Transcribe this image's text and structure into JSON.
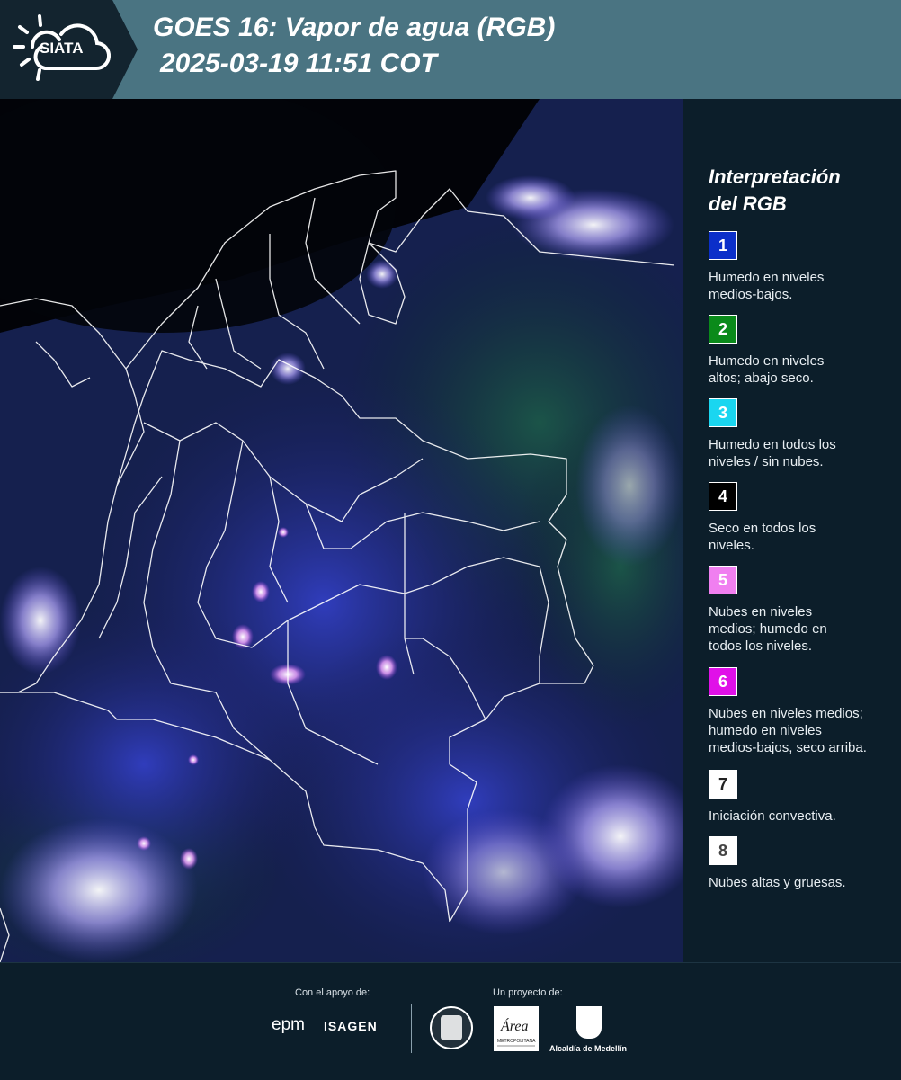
{
  "header": {
    "logo_text": "SIATA",
    "title_line1": "GOES 16: Vapor de agua (RGB)",
    "title_line2": "2025-03-19 11:51 COT"
  },
  "legend": {
    "title_line1": "Interpretación",
    "title_line2": "del RGB",
    "items": [
      {
        "number": "1",
        "color": "#0b2fc9",
        "text_color": "#ffffff",
        "desc_line1": "Humedo en niveles",
        "desc_line2": "medios-bajos.",
        "desc_line3": ""
      },
      {
        "number": "2",
        "color": "#0a8a1a",
        "text_color": "#ffffff",
        "desc_line1": "Humedo en niveles",
        "desc_line2": "altos; abajo seco.",
        "desc_line3": ""
      },
      {
        "number": "3",
        "color": "#1ad6f0",
        "text_color": "#ffffff",
        "desc_line1": "Humedo en todos los",
        "desc_line2": "niveles / sin nubes.",
        "desc_line3": ""
      },
      {
        "number": "4",
        "color": "#000000",
        "text_color": "#ffffff",
        "desc_line1": "Seco en todos los",
        "desc_line2": "niveles.",
        "desc_line3": ""
      },
      {
        "number": "5",
        "color": "#f07ff0",
        "text_color": "#ffffff",
        "desc_line1": "Nubes en niveles",
        "desc_line2": "medios; humedo en",
        "desc_line3": "todos los niveles."
      },
      {
        "number": "6",
        "color": "#e010e8",
        "text_color": "#ffffff",
        "desc_line1": "Nubes en niveles medios;",
        "desc_line2": "humedo en niveles",
        "desc_line3": "medios-bajos, seco arriba."
      },
      {
        "number": "7",
        "color": "#ffffff",
        "text_color": "#222222",
        "desc_line1": "Iniciación convectiva.",
        "desc_line2": "",
        "desc_line3": ""
      },
      {
        "number": "8",
        "color": "#ffffff",
        "text_color": "#444444",
        "desc_line1": "Nubes altas y gruesas.",
        "desc_line2": "",
        "desc_line3": ""
      }
    ]
  },
  "footer": {
    "support_label": "Con el apoyo de:",
    "project_label": "Un proyecto de:",
    "epm": "epm",
    "isagen": "ISAGEN",
    "metro_text": "Área",
    "metro_sub": "METROPOLITANA",
    "medellin": "Alcaldía de Medellín"
  },
  "colors": {
    "header_bg": "#4a7482",
    "panel_bg": "#0c1e2a"
  }
}
